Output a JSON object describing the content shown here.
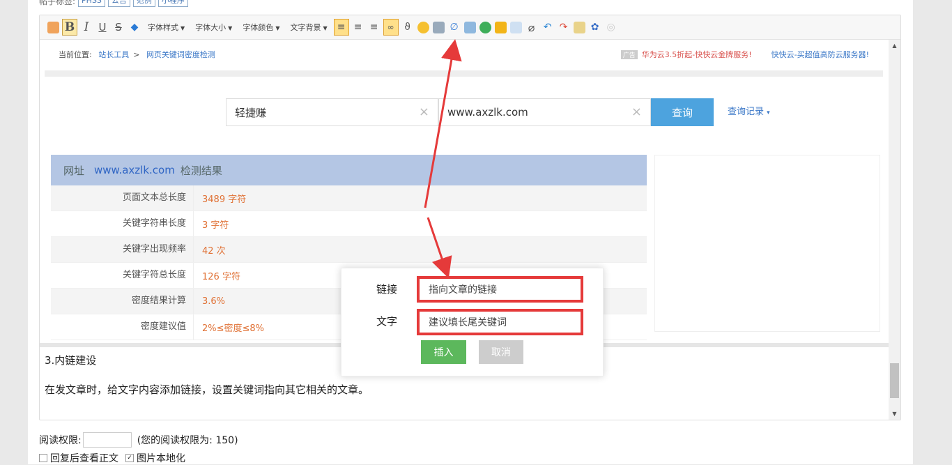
{
  "tags": {
    "prefix": "帖子标签:",
    "items": [
      "PHSS",
      "公告",
      "范例",
      "小程序"
    ]
  },
  "toolbar": {
    "dropdowns": [
      "字体样式",
      "字体大小",
      "字体颜色",
      "文字背景"
    ],
    "bold": "B",
    "italic": "I",
    "underline": "U",
    "strike": "S"
  },
  "screenshot": {
    "breadcrumb_prefix": "当前位置:",
    "breadcrumb_links": [
      "站长工具",
      "网页关键词密度检测"
    ],
    "breadcrumb_sep": ">",
    "ad_badge": "广告",
    "promo_1": "华为云3.5折起-快快云金牌服务!",
    "promo_2": "快快云-买超值高防云服务器!",
    "search": {
      "keyword_value": "轻捷赚",
      "url_value": "www.axzlk.com",
      "button": "查询",
      "history": "查询记录",
      "clear_icon": "×"
    },
    "result": {
      "head_prefix": "网址",
      "head_site": "www.axzlk.com",
      "head_suffix": "检测结果",
      "rows": [
        {
          "label": "页面文本总长度",
          "value": "3489 字符"
        },
        {
          "label": "关键字符串长度",
          "value": "3 字符"
        },
        {
          "label": "关键字出现频率",
          "value": "42 次"
        },
        {
          "label": "关键字符总长度",
          "value": "126 字符"
        },
        {
          "label": "密度结果计算",
          "value": "3.6%"
        },
        {
          "label": "密度建议值",
          "value": "2%≤密度≤8%"
        }
      ]
    }
  },
  "article": {
    "heading": "3.内链建设",
    "paragraph": "在发文章时，给文字内容添加链接，设置关键词指向其它相关的文章。"
  },
  "dialog": {
    "link_label": "链接",
    "link_placeholder": "指向文章的链接",
    "text_label": "文字",
    "text_placeholder": "建议填长尾关键词",
    "insert": "插入",
    "cancel": "取消"
  },
  "bottom": {
    "perm_label": "阅读权限:",
    "perm_note": "(您的阅读权限为: 150)",
    "opt1": "回复后查看正文",
    "opt2": "图片本地化"
  },
  "colors": {
    "accent_blue": "#4da3de",
    "insert_green": "#5cb85c",
    "highlight_red": "#e53a3a",
    "value_orange": "#e07135"
  }
}
